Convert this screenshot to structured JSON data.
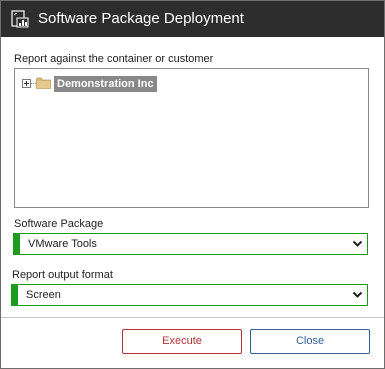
{
  "dialog": {
    "title": "Software Package Deployment",
    "title_icon": "report-chart-icon"
  },
  "scope": {
    "label": "Report against the container or customer",
    "tree": {
      "root_label": "Demonstration Inc",
      "root_icon": "folder-icon",
      "expander_icon": "plus-expander-icon",
      "selected": true
    }
  },
  "software_package": {
    "label": "Software Package",
    "value": "VMware Tools",
    "icon": "chevron-down-icon"
  },
  "output_format": {
    "label": "Report output format",
    "value": "Screen",
    "icon": "chevron-down-icon"
  },
  "buttons": {
    "execute": "Execute",
    "close": "Close"
  },
  "colors": {
    "titlebar": "#2d2d2d",
    "valid_accent": "#1c9b1c",
    "execute_accent": "#b23434",
    "close_accent": "#2f5f9a",
    "selection": "#888888"
  }
}
